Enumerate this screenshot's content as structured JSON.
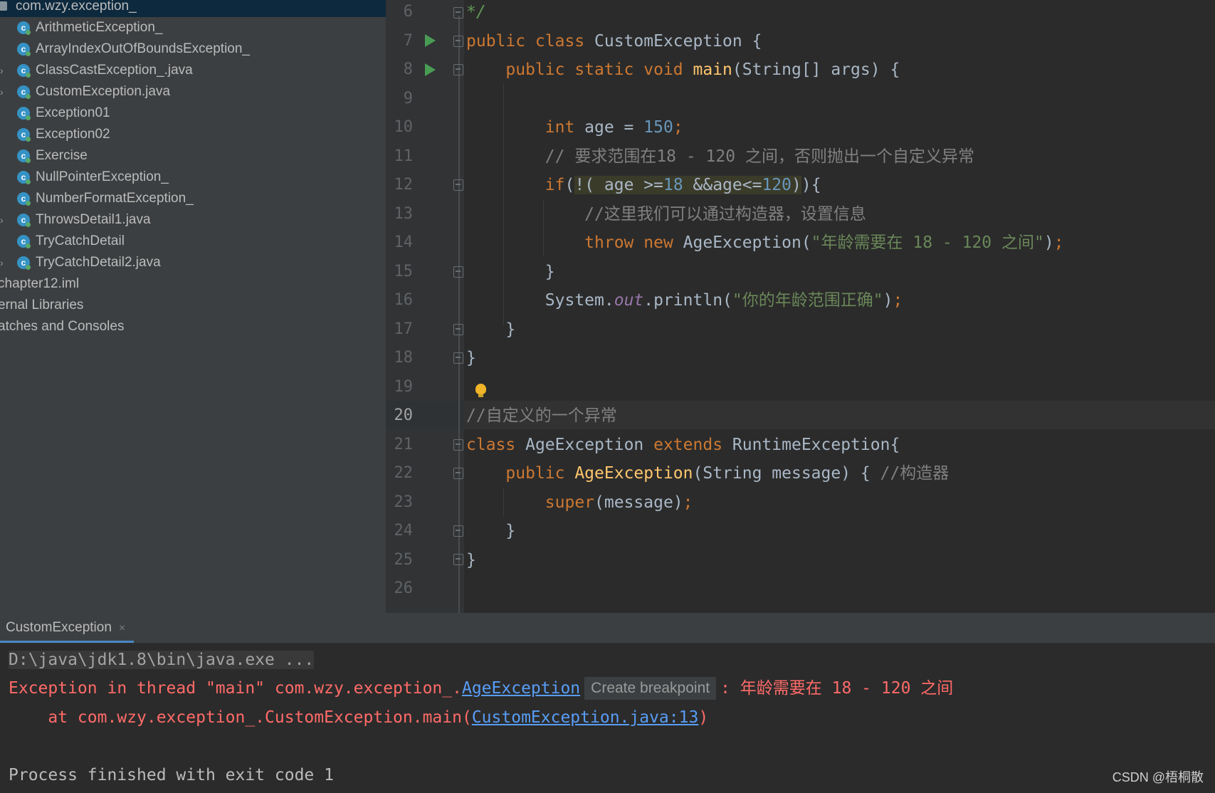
{
  "project_tree": {
    "package": "com.wzy.exception_",
    "items": [
      {
        "label": "ArithmeticException_",
        "expandable": false
      },
      {
        "label": "ArrayIndexOutOfBoundsException_",
        "expandable": false
      },
      {
        "label": "ClassCastException_.java",
        "expandable": true
      },
      {
        "label": "CustomException.java",
        "expandable": true
      },
      {
        "label": "Exception01",
        "expandable": false
      },
      {
        "label": "Exception02",
        "expandable": false
      },
      {
        "label": "Exercise",
        "expandable": false
      },
      {
        "label": "NullPointerException_",
        "expandable": false
      },
      {
        "label": "NumberFormatException_",
        "expandable": false
      },
      {
        "label": "ThrowsDetail1.java",
        "expandable": true
      },
      {
        "label": "TryCatchDetail",
        "expandable": false
      },
      {
        "label": "TryCatchDetail2.java",
        "expandable": true
      }
    ],
    "bottom_items": [
      "chapter12.iml",
      "ernal Libraries",
      "atches and Consoles"
    ],
    "class_icon_letter": "c"
  },
  "editor": {
    "line_numbers": [
      "6",
      "7",
      "8",
      "9",
      "10",
      "11",
      "12",
      "13",
      "14",
      "15",
      "16",
      "17",
      "18",
      "19",
      "20",
      "21",
      "22",
      "23",
      "24",
      "25",
      "26"
    ],
    "current_line": "20",
    "lines": {
      "l6": {
        "c1": "*/"
      },
      "l7": {
        "k1": "public class ",
        "n1": "CustomException {"
      },
      "l8": {
        "k1": "public static void ",
        "f1": "main",
        "p1": "(String[] args) {"
      },
      "l10": {
        "k1": "int ",
        "p1": "age = ",
        "n1": "150",
        "k2": ";"
      },
      "l11": {
        "c1": "// 要求范围在18 - 120 之间，否则抛出一个自定义异常"
      },
      "l12": {
        "k1": "if",
        "p1": "(",
        "h1": "!( age >=",
        "h2": "18",
        "h3": " &&age<=",
        "h4": "120",
        "h5": ")",
        "p2": "){"
      },
      "l13": {
        "c1": "//这里我们可以通过构造器，设置信息"
      },
      "l14": {
        "k1": "throw new ",
        "p1": "AgeException(",
        "s1": "\"年龄需要在 18 - 120 之间\"",
        "p2": ")",
        "k2": ";"
      },
      "l15": {
        "p1": "}"
      },
      "l16": {
        "p1": "System.",
        "st1": "out",
        "p2": ".println(",
        "s1": "\"你的年龄范围正确\"",
        "p3": ")",
        "k1": ";"
      },
      "l17": {
        "p1": "}"
      },
      "l18": {
        "p1": "}"
      },
      "l20": {
        "c1": "//自定义的一个异常"
      },
      "l21": {
        "k1": "class ",
        "p1": "AgeException ",
        "k2": "extends ",
        "p2": "RuntimeException{"
      },
      "l22": {
        "k1": "public ",
        "f1": "AgeException",
        "p1": "(String message) { ",
        "c1": "//构造器"
      },
      "l23": {
        "k1": "super",
        "p1": "(message)",
        "k2": ";"
      },
      "l24": {
        "p1": "}"
      },
      "l25": {
        "p1": "}"
      }
    }
  },
  "run_panel": {
    "tab_label": "CustomException",
    "tab_close": "×",
    "cmd_line": "D:\\java\\jdk1.8\\bin\\java.exe ...",
    "exc_prefix": "Exception in thread \"main\" com.wzy.exception_.",
    "exc_link": "AgeException",
    "breakpoint_hint": "Create breakpoint",
    "exc_suffix": ": 年龄需要在 18 - 120 之间",
    "at_prefix": "    at com.wzy.exception_.CustomException.main(",
    "at_link": "CustomException.java:13",
    "at_suffix": ")",
    "exit_line": "Process finished with exit code 1"
  },
  "watermark": "CSDN @梧桐散",
  "colors": {
    "keyword": "#cc7832",
    "function": "#ffc66d",
    "number": "#6897bb",
    "string": "#6a8759",
    "comment": "#808080",
    "error": "#ff6b68",
    "link": "#589df6",
    "run_icon": "#499c54"
  }
}
